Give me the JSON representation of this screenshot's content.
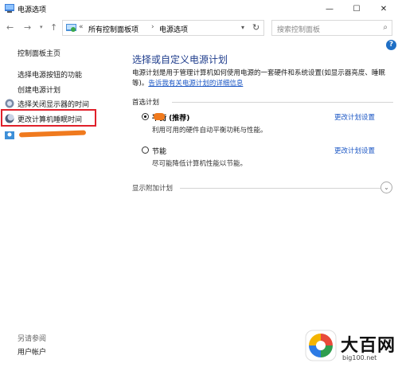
{
  "window": {
    "title": "电源选项",
    "minimize": "—",
    "maximize": "☐",
    "close": "✕"
  },
  "toolbar": {
    "back": "←",
    "forward": "→",
    "recent": "▾",
    "up": "↑"
  },
  "address": {
    "sep": "«",
    "crumb1": "所有控制面板项",
    "sep2": "›",
    "crumb2": "电源选项",
    "dropdown": "▾",
    "refresh": "↻"
  },
  "search": {
    "placeholder": "搜索控制面板",
    "icon": "⌕"
  },
  "help": {
    "label": "?"
  },
  "sidebar": {
    "home": "控制面板主页",
    "power_buttons": "选择电源按钮的功能",
    "create_plan": "创建电源计划",
    "display_off": "选择关闭显示器的时间",
    "sleep": "更改计算机睡眠时间",
    "see_also": "另请参阅",
    "user_accounts": "用户帐户"
  },
  "main": {
    "title": "选择或自定义电源计划",
    "desc": "电源计划是用于管理计算机如何使用电源的一套硬件和系统设置(如显示器亮度、睡眠等)。",
    "desc_link": "告诉我有关电源计划的详细信息",
    "preferred_label": "首选计划",
    "plans": [
      {
        "name": "平衡 (推荐)",
        "desc": "利用可用的硬件自动平衡功耗与性能。",
        "link": "更改计划设置"
      },
      {
        "name": "节能",
        "desc": "尽可能降低计算机性能以节能。",
        "link": "更改计划设置"
      }
    ],
    "more_label": "显示附加计划",
    "more_icon": "⌄"
  },
  "watermark": {
    "text": "大百网",
    "url": "big100.net"
  },
  "colors": {
    "accent": "#1e3c8c",
    "link": "#1a56c4",
    "highlight": "#e0202a",
    "scribble": "#f07a1e"
  }
}
